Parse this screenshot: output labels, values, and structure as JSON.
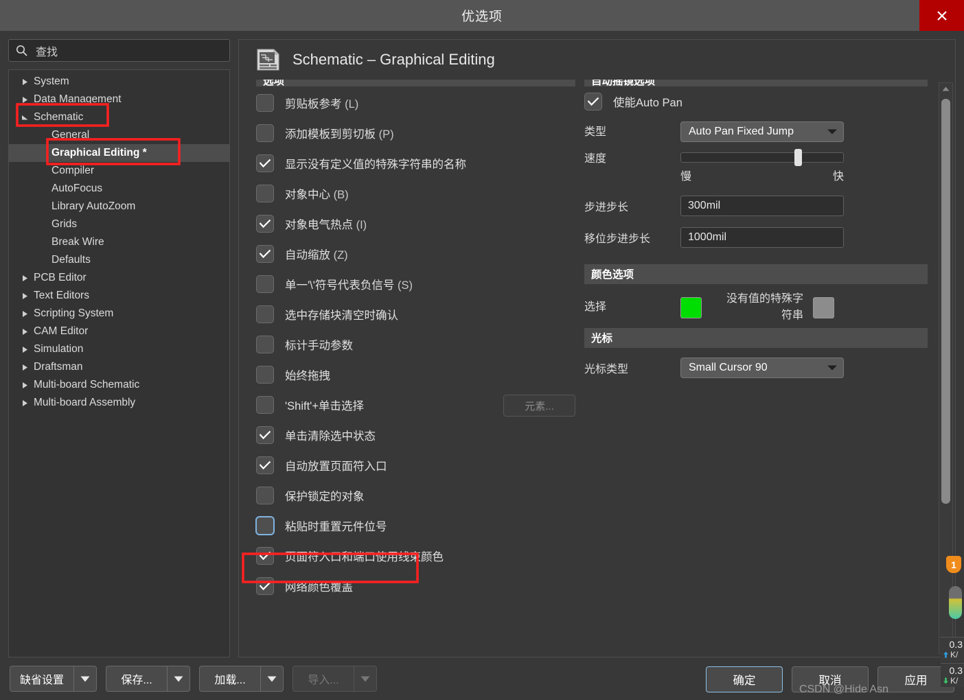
{
  "window": {
    "title": "优选项",
    "close_icon": "close-icon"
  },
  "search": {
    "placeholder": "查找",
    "icon": "search-icon"
  },
  "sidebar": {
    "items": [
      {
        "label": "System",
        "level": 1,
        "twisty": "collapsed",
        "selected": false
      },
      {
        "label": "Data Management",
        "level": 1,
        "twisty": "collapsed",
        "selected": false
      },
      {
        "label": "Schematic",
        "level": 1,
        "twisty": "expanded",
        "selected": false,
        "annotated": true
      },
      {
        "label": "General",
        "level": 2,
        "twisty": "none",
        "selected": false
      },
      {
        "label": "Graphical Editing *",
        "level": 2,
        "twisty": "none",
        "selected": true,
        "annotated": true
      },
      {
        "label": "Compiler",
        "level": 2,
        "twisty": "none",
        "selected": false
      },
      {
        "label": "AutoFocus",
        "level": 2,
        "twisty": "none",
        "selected": false
      },
      {
        "label": "Library AutoZoom",
        "level": 2,
        "twisty": "none",
        "selected": false
      },
      {
        "label": "Grids",
        "level": 2,
        "twisty": "none",
        "selected": false
      },
      {
        "label": "Break Wire",
        "level": 2,
        "twisty": "none",
        "selected": false
      },
      {
        "label": "Defaults",
        "level": 2,
        "twisty": "none",
        "selected": false
      },
      {
        "label": "PCB Editor",
        "level": 1,
        "twisty": "collapsed",
        "selected": false
      },
      {
        "label": "Text Editors",
        "level": 1,
        "twisty": "collapsed",
        "selected": false
      },
      {
        "label": "Scripting System",
        "level": 1,
        "twisty": "collapsed",
        "selected": false
      },
      {
        "label": "CAM Editor",
        "level": 1,
        "twisty": "collapsed",
        "selected": false
      },
      {
        "label": "Simulation",
        "level": 1,
        "twisty": "collapsed",
        "selected": false
      },
      {
        "label": "Draftsman",
        "level": 1,
        "twisty": "collapsed",
        "selected": false
      },
      {
        "label": "Multi-board Schematic",
        "level": 1,
        "twisty": "collapsed",
        "selected": false
      },
      {
        "label": "Multi-board Assembly",
        "level": 1,
        "twisty": "collapsed",
        "selected": false
      }
    ]
  },
  "page": {
    "title": "Schematic – Graphical Editing",
    "icon": "schematic-document-icon"
  },
  "options_column": {
    "group_header_clipped": "选项",
    "checkboxes": [
      {
        "label": "剪贴板参考",
        "accel": "(L)",
        "checked": false
      },
      {
        "label": "添加模板到剪切板",
        "accel": "(P)",
        "checked": false
      },
      {
        "label": "显示没有定义值的特殊字符串的名称",
        "accel": "",
        "checked": true
      },
      {
        "label": "对象中心",
        "accel": "(B)",
        "checked": false
      },
      {
        "label": "对象电气热点",
        "accel": "(I)",
        "checked": true
      },
      {
        "label": "自动缩放",
        "accel": "(Z)",
        "checked": true
      },
      {
        "label": "单一'\\'符号代表负信号",
        "accel": "(S)",
        "checked": false
      },
      {
        "label": "选中存储块清空时确认",
        "accel": "",
        "checked": false
      },
      {
        "label": "标计手动参数",
        "accel": "",
        "checked": false
      },
      {
        "label": "始终拖拽",
        "accel": "",
        "checked": false
      },
      {
        "label": "'Shift'+单击选择",
        "accel": "",
        "checked": false,
        "side_button": "元素..."
      },
      {
        "label": "单击清除选中状态",
        "accel": "",
        "checked": true
      },
      {
        "label": "自动放置页面符入口",
        "accel": "",
        "checked": true
      },
      {
        "label": "保护锁定的对象",
        "accel": "",
        "checked": false
      },
      {
        "label": "粘贴时重置元件位号",
        "accel": "",
        "checked": false,
        "annotated": true,
        "focused": true
      },
      {
        "label": "页面符入口和端口使用线束颜色",
        "accel": "",
        "checked": true
      },
      {
        "label": "网络颜色覆盖",
        "accel": "",
        "checked": true
      }
    ]
  },
  "autopan": {
    "group_header_clipped": "自动摇镜选项",
    "enable": {
      "label": "使能Auto Pan",
      "checked": true
    },
    "type": {
      "label": "类型",
      "value": "Auto Pan Fixed Jump",
      "icon": "chevron-down-icon"
    },
    "speed": {
      "label": "速度",
      "min_label": "慢",
      "max_label": "快",
      "percent": 72
    },
    "step_size": {
      "label": "步进步长",
      "value": "300mil"
    },
    "shift_step_size": {
      "label": "移位步进步长",
      "value": "1000mil"
    }
  },
  "color_options": {
    "header": "颜色选项",
    "selection": {
      "label": "选择",
      "color": "#00DD00"
    },
    "no_value_special_string": {
      "label": "没有值的特殊字符串",
      "color": "#8C8C8C"
    }
  },
  "cursor": {
    "header": "光标",
    "type": {
      "label": "光标类型",
      "value": "Small Cursor 90",
      "icon": "chevron-down-icon"
    }
  },
  "scrollbar": {
    "up_icon": "triangle-up-icon",
    "down_icon": "triangle-down-icon"
  },
  "footer": {
    "left_buttons": [
      {
        "label": "缺省设置",
        "disabled": false
      },
      {
        "label": "保存...",
        "disabled": false
      },
      {
        "label": "加载...",
        "disabled": false
      },
      {
        "label": "导入...",
        "disabled": true
      }
    ],
    "right_buttons": [
      {
        "label": "确定",
        "primary": true
      },
      {
        "label": "取消",
        "primary": false
      },
      {
        "label": "应用",
        "primary": false
      }
    ],
    "watermark": "CSDN @Hide Asn"
  },
  "net_widget": {
    "badge": "1",
    "up_value": "0.3",
    "up_unit": "K/",
    "down_value": "0.3",
    "down_unit": "K/",
    "up_icon": "arrow-up-icon",
    "down_icon": "arrow-down-icon"
  }
}
